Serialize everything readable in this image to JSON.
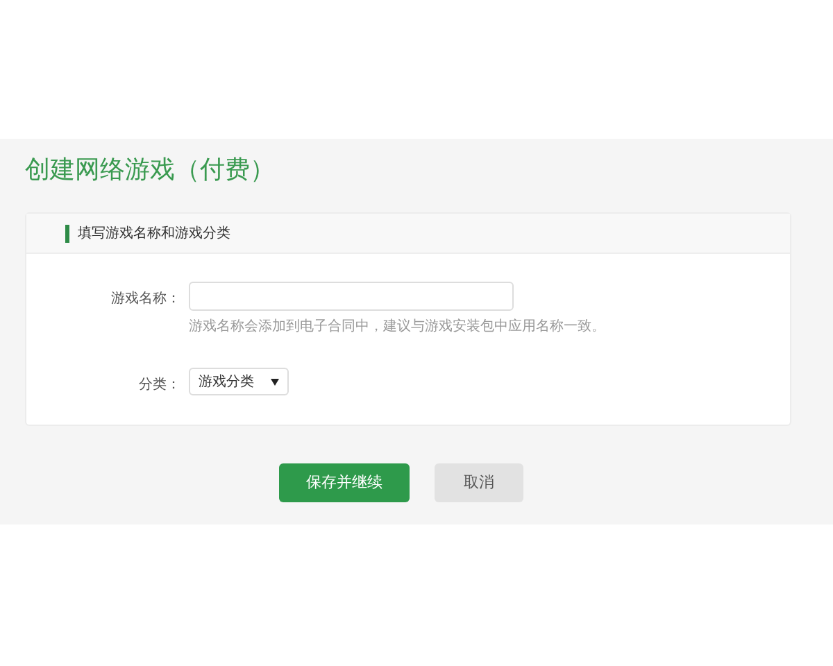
{
  "page_title": "创建网络游戏（付费）",
  "section": {
    "title": "填写游戏名称和游戏分类"
  },
  "fields": [
    {
      "kind": "text",
      "label": "游戏名称：",
      "hint": "游戏名称会添加到电子合同中，建议与游戏安装包中应用名称一致。"
    },
    {
      "kind": "select",
      "label": "分类：",
      "value": "游戏分类"
    }
  ],
  "buttons": [
    {
      "label": "保存并继续",
      "kind": "primary"
    },
    {
      "label": "取消",
      "kind": "secondary"
    }
  ]
}
